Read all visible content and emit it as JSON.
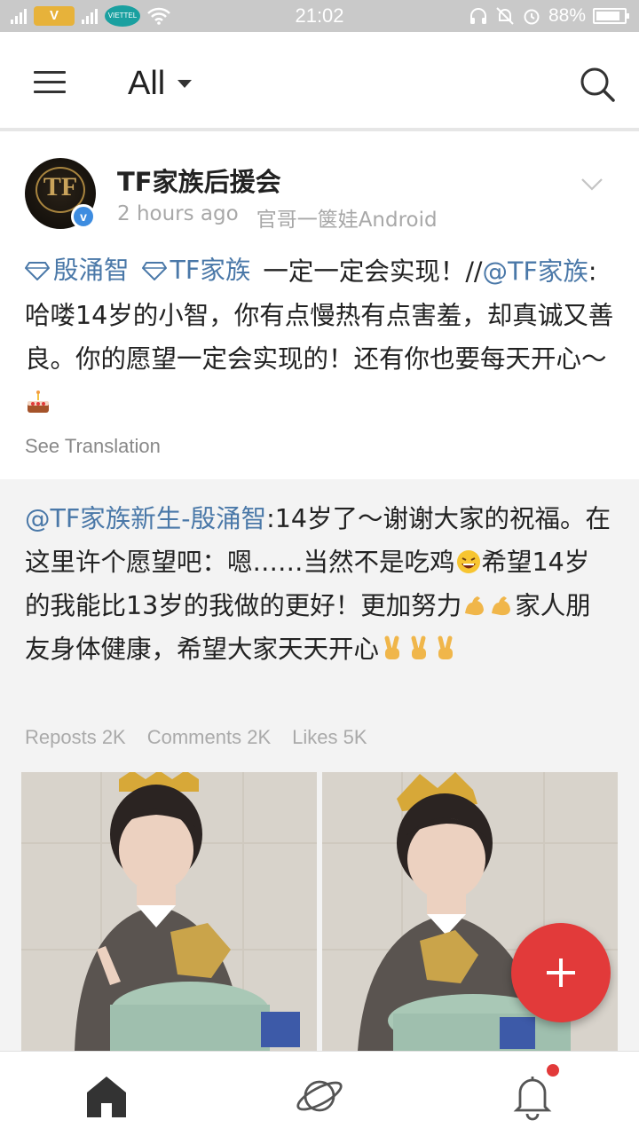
{
  "status_bar": {
    "time": "21:02",
    "battery": "88%",
    "carrier_logo": "V",
    "carrier2": "VIETTEL"
  },
  "app_bar": {
    "filter_label": "All"
  },
  "post": {
    "author": "TF家族后援会",
    "time": "2 hours ago",
    "source": "官哥一箧娃Android",
    "avatar_text": "TF",
    "topic1": "殷涌智",
    "topic2": "TF家族",
    "text_a": "一定一定会实现！//",
    "mention1": "@TF家族",
    "text_b": ":哈喽14岁的小智，你有点慢热有点害羞，却真诚又善良。你的愿望一定会实现的！还有你也要每天开心～",
    "see_translation": "See Translation"
  },
  "repost": {
    "mention": "@TF家族新生-殷涌智",
    "text_a": ":14岁了～谢谢大家的祝福。在这里许个愿望吧：嗯……当然不是吃鸡",
    "text_b": "希望14岁的我能比13岁的我做的更好！更加努力",
    "text_c": "家人朋友身体健康，希望大家天天开心",
    "reposts": "Reposts 2K",
    "comments": "Comments 2K",
    "likes": "Likes 5K"
  },
  "colors": {
    "link": "#4a78a8",
    "fab": "#e23a3a",
    "status_bar": "#c9c9c9"
  },
  "icons": [
    "menu-icon",
    "chevron-down-icon",
    "search-icon",
    "diamond-icon",
    "verified-icon",
    "cake-emoji",
    "laughing-emoji",
    "muscle-emoji",
    "victory-emoji",
    "plus-icon",
    "home-icon",
    "planet-icon",
    "bell-icon"
  ]
}
